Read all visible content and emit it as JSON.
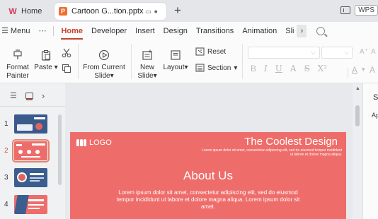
{
  "titlebar": {
    "home_tab": "Home",
    "doc_tab": "Cartoon G...tion.pptx",
    "new_tab_symbol": "+",
    "wps_label": "WPS"
  },
  "menubar": {
    "menu_label": "Menu",
    "more_label": "⋯",
    "items": [
      "Home",
      "Developer",
      "Insert",
      "Design",
      "Transitions",
      "Animation",
      "Sli"
    ],
    "active": "Home",
    "overflow_chevron": "›"
  },
  "ribbon": {
    "format_painter": "Format\nPainter",
    "paste": "Paste",
    "from_current_slide": "From Current\nSlide",
    "new_slide": "New\nSlide",
    "layout": "Layout",
    "reset": "Reset",
    "section": "Section",
    "font_buttons": [
      "B",
      "I",
      "U",
      "A",
      "S",
      "X²"
    ],
    "grow_font": "A⁺",
    "font_color": "A"
  },
  "thumbnails": {
    "numbers": [
      "1",
      "2",
      "3",
      "4"
    ],
    "selected_index": 2
  },
  "slide": {
    "logo_text": "LOGO",
    "title": "The Coolest Design",
    "subtitle": "Lorem ipsum dolor sit amet, consectetur adipiscing elit, sed do eiusmod tempor incididunt ut labore et dolore magna aliqua.",
    "heading": "About Us",
    "body": "Lorem ipsum dolor sit amet, consectetur adipiscing elit, sed do eiusmod tempor incididunt ut labore et dolore magna aliqua. Lorem ipsum dolor sit amet.",
    "background_color": "#ee6d6a"
  },
  "rightpanel": {
    "title_partial": "Sl",
    "label_partial": "Ap"
  },
  "colors": {
    "accent": "#c4442f",
    "doc_icon": "#ef6f2e",
    "slide_bg": "#ee6d6a"
  }
}
